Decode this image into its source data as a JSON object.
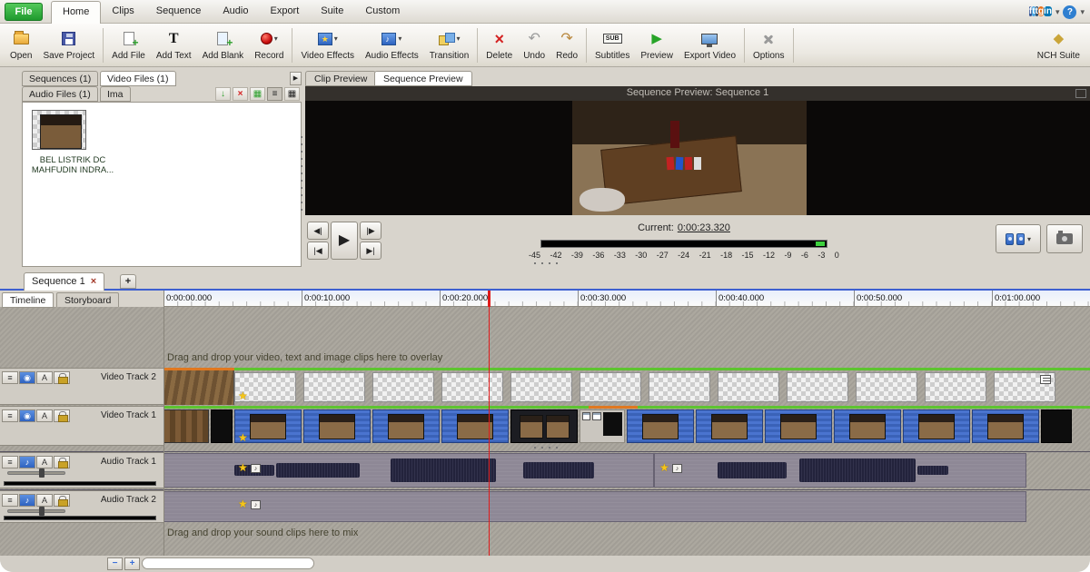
{
  "menu": {
    "file_label": "File",
    "tabs": [
      "Home",
      "Clips",
      "Sequence",
      "Audio",
      "Export",
      "Suite",
      "Custom"
    ],
    "active_tab": "Home",
    "help_label": "?",
    "social": [
      {
        "name": "facebook",
        "glyph": "f",
        "color": "#3b5998"
      },
      {
        "name": "twitter",
        "glyph": "t",
        "color": "#4ea7e0"
      },
      {
        "name": "tumblr",
        "glyph": "t",
        "color": "#34526f"
      },
      {
        "name": "googleplus",
        "glyph": "g",
        "color": "#e8711a"
      },
      {
        "name": "linkedin",
        "glyph": "in",
        "color": "#0077b5"
      }
    ]
  },
  "toolbar": {
    "open": "Open",
    "save": "Save Project",
    "add_file": "Add File",
    "add_text": "Add Text",
    "add_blank": "Add Blank",
    "record": "Record",
    "video_effects": "Video Effects",
    "audio_effects": "Audio Effects",
    "transition": "Transition",
    "delete": "Delete",
    "undo": "Undo",
    "redo": "Redo",
    "subtitles": "Subtitles",
    "sub_badge": "SUB",
    "preview": "Preview",
    "export_video": "Export Video",
    "options": "Options",
    "nch_suite": "NCH Suite"
  },
  "media_panel": {
    "tabs": [
      "Sequences (1)",
      "Video Files (1)",
      "Audio Files (1)",
      "Ima"
    ],
    "active_tab": "Video Files (1)",
    "file_name": "BEL LISTRIK DC MAHFUDIN INDRA..."
  },
  "preview_panel": {
    "tabs": [
      "Clip Preview",
      "Sequence Preview"
    ],
    "active_tab": "Sequence Preview",
    "overlay_title": "Sequence Preview: Sequence 1",
    "current_label": "Current:",
    "current_time": "0:00:23.320",
    "meter_scale": [
      "-45",
      "-42",
      "-39",
      "-36",
      "-33",
      "-30",
      "-27",
      "-24",
      "-21",
      "-18",
      "-15",
      "-12",
      "-9",
      "-6",
      "-3",
      "0"
    ]
  },
  "sequence_bar": {
    "tab": "Sequence 1",
    "close": "×",
    "add": "+"
  },
  "timeline": {
    "view_tabs": [
      "Timeline",
      "Storyboard"
    ],
    "active_view": "Timeline",
    "ruler": [
      "0:00:00.000",
      "0:00:10.000",
      "0:00:20.000",
      "0:00:30.000",
      "0:00:40.000",
      "0:00:50.000",
      "0:01:00.000"
    ],
    "video_hint": "Drag and drop your video, text and image clips here to overlay",
    "audio_hint": "Drag and drop your sound clips here to mix",
    "tracks": [
      {
        "name": "Video Track 2",
        "type": "video"
      },
      {
        "name": "Video Track 1",
        "type": "video"
      },
      {
        "name": "Audio Track 1",
        "type": "audio"
      },
      {
        "name": "Audio Track 2",
        "type": "audio"
      }
    ],
    "playhead_time": "0:00:23.320"
  },
  "colors": {
    "accent_green": "#5ec431",
    "clip_blue": "#3a62b8",
    "playhead_red": "#e01b1b",
    "record_red": "#cc1111",
    "file_button_green": "#2e9a38",
    "timeline_blue_line": "#3d5fd0"
  }
}
